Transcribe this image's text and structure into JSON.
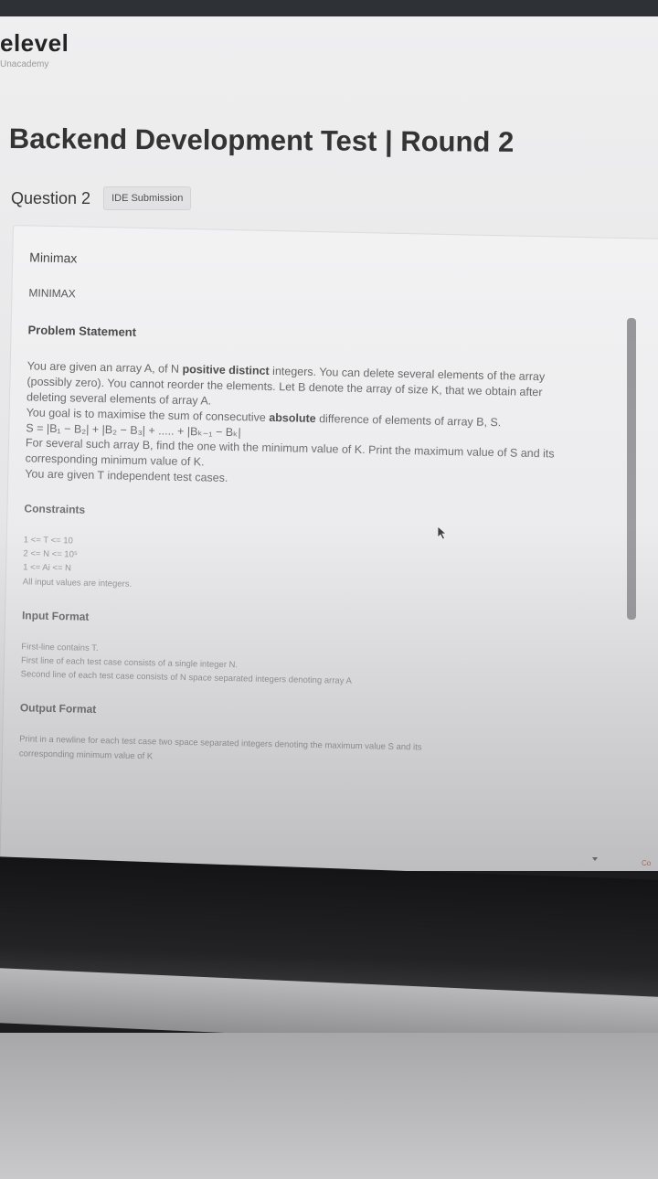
{
  "brand": {
    "name": "elevel",
    "sub": "Unacademy"
  },
  "page_title": "Backend Development Test | Round 2",
  "question": {
    "label": "Question 2",
    "badge": "IDE Submission"
  },
  "problem": {
    "name": "Minimax",
    "code": "MINIMAX",
    "statement_heading": "Problem Statement",
    "statement": {
      "l1_a": "You are given an array A, of N ",
      "l1_b": "positive distinct",
      "l1_c": " integers. You can delete several elements of the array",
      "l2": "(possibly zero). You cannot reorder the elements. Let B denote the array of size K, that we obtain after",
      "l3": "deleting several elements of array A.",
      "l4_a": "You goal is to maximise the sum of consecutive ",
      "l4_b": "absolute",
      "l4_c": " difference of elements of array B, S.",
      "l5": "S = |B₁ − B₂| + |B₂ − B₃| + ..... + |Bₖ₋₁ − Bₖ|",
      "l6": "For several such array B, find the one with the minimum value of K. Print the maximum value of S and its",
      "l7": "corresponding minimum value of K.",
      "l8": "You are given T independent test cases."
    },
    "constraints_heading": "Constraints",
    "constraints": [
      "1 <= T <= 10",
      "2 <= N <= 10⁵",
      "1 <= Ai <= N",
      "All input values are integers."
    ],
    "input_heading": "Input Format",
    "input_lines": [
      "First-line contains T.",
      "First line of each test case consists of a single integer N.",
      "Second line of each test case consists of N space separated integers denoting array A"
    ],
    "output_heading": "Output Format",
    "output_lines": [
      "Print in a newline for each test case two space separated integers denoting the maximum value S and its",
      "corresponding minimum value of K"
    ]
  },
  "edge_text": "Co"
}
